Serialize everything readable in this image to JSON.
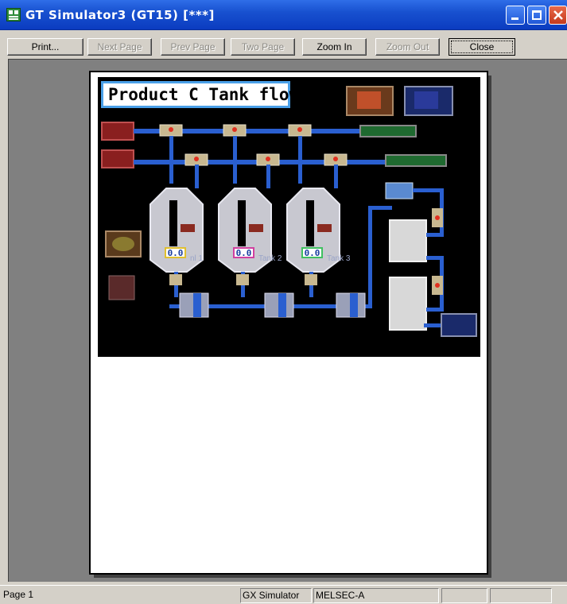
{
  "window": {
    "title": "GT Simulator3 (GT15)  [***]"
  },
  "toolbar": {
    "print": "Print...",
    "next_page": "Next Page",
    "prev_page": "Prev Page",
    "two_page": "Two Page",
    "zoom_in": "Zoom In",
    "zoom_out": "Zoom Out",
    "close": "Close"
  },
  "hmi": {
    "title": "Product C Tank flow",
    "tank_labels": [
      "nl 1",
      "Tank 2",
      "Tank 3"
    ],
    "tank_values": [
      "0.0",
      "0.0",
      "0.0"
    ]
  },
  "statusbar": {
    "page": "Page 1",
    "simulator": "GX Simulator",
    "plc_type": "MELSEC-A"
  },
  "colors": {
    "titlebar": "#1851d0",
    "hmi_background": "#000000",
    "pipe": "#2a5fd0",
    "title_border": "#4aa0e8"
  }
}
